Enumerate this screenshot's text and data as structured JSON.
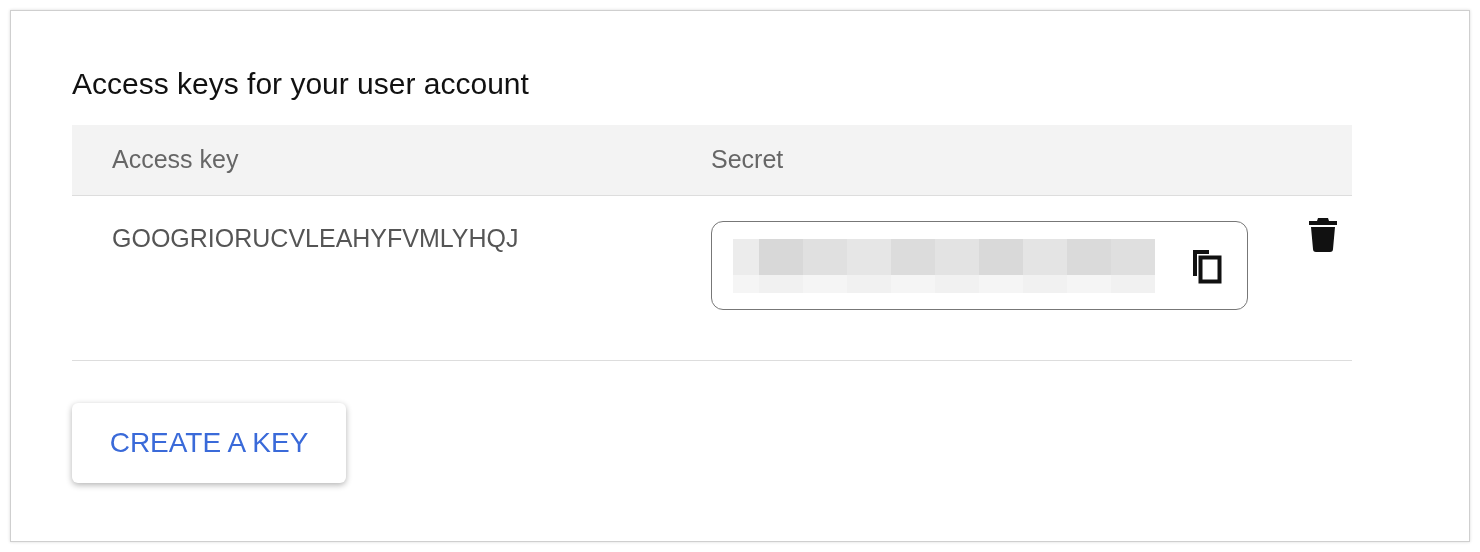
{
  "title": "Access keys for your user account",
  "table": {
    "columns": [
      "Access key",
      "Secret"
    ],
    "rows": [
      {
        "access_key": "GOOGRIORUCVLEAHYFVMLYHQJ"
      }
    ]
  },
  "create_button": "CREATE A KEY"
}
